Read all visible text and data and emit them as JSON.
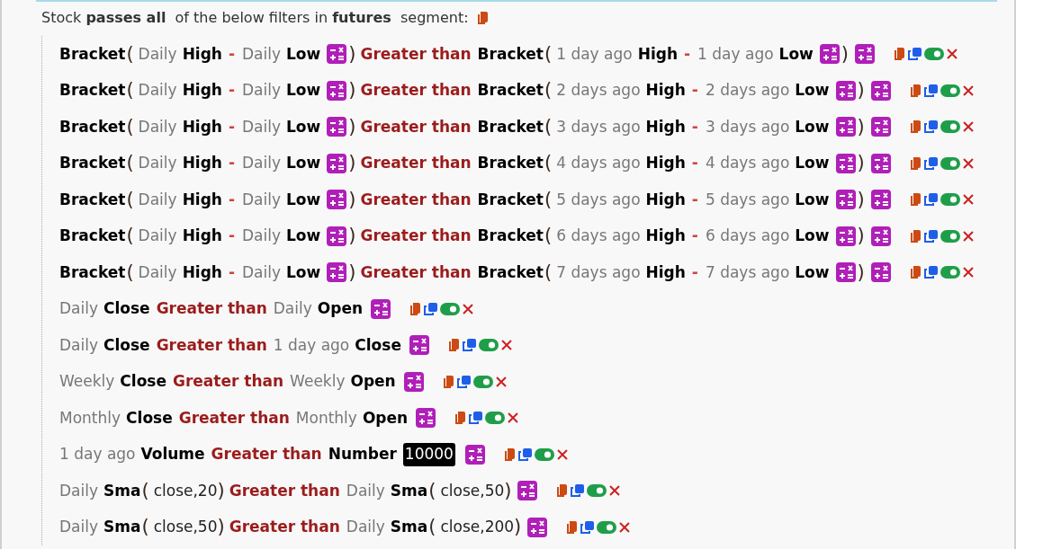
{
  "header": {
    "text": "Stock **passes all**  of the below filters in **futures**  segment:"
  },
  "filters": [
    {
      "enabled": true,
      "tokens": [
        {
          "kind": "bold",
          "text": "Bracket"
        },
        {
          "kind": "paren",
          "text": "("
        },
        {
          "kind": "muted",
          "text": "Daily"
        },
        {
          "kind": "bold",
          "text": "High"
        },
        {
          "kind": "minus",
          "text": "-"
        },
        {
          "kind": "muted",
          "text": "Daily"
        },
        {
          "kind": "bold",
          "text": "Low"
        },
        {
          "kind": "calc"
        },
        {
          "kind": "paren",
          "text": ")"
        },
        {
          "kind": "op",
          "text": "Greater than"
        },
        {
          "kind": "bold",
          "text": "Bracket"
        },
        {
          "kind": "paren",
          "text": "("
        },
        {
          "kind": "muted",
          "text": "1 day ago"
        },
        {
          "kind": "bold",
          "text": "High"
        },
        {
          "kind": "minus",
          "text": "-"
        },
        {
          "kind": "muted",
          "text": "1 day ago"
        },
        {
          "kind": "bold",
          "text": "Low"
        },
        {
          "kind": "calc"
        },
        {
          "kind": "paren",
          "text": ")"
        },
        {
          "kind": "calc"
        }
      ]
    },
    {
      "enabled": true,
      "tokens": [
        {
          "kind": "bold",
          "text": "Bracket"
        },
        {
          "kind": "paren",
          "text": "("
        },
        {
          "kind": "muted",
          "text": "Daily"
        },
        {
          "kind": "bold",
          "text": "High"
        },
        {
          "kind": "minus",
          "text": "-"
        },
        {
          "kind": "muted",
          "text": "Daily"
        },
        {
          "kind": "bold",
          "text": "Low"
        },
        {
          "kind": "calc"
        },
        {
          "kind": "paren",
          "text": ")"
        },
        {
          "kind": "op",
          "text": "Greater than"
        },
        {
          "kind": "bold",
          "text": "Bracket"
        },
        {
          "kind": "paren",
          "text": "("
        },
        {
          "kind": "muted",
          "text": "2 days ago"
        },
        {
          "kind": "bold",
          "text": "High"
        },
        {
          "kind": "minus",
          "text": "-"
        },
        {
          "kind": "muted",
          "text": "2 days ago"
        },
        {
          "kind": "bold",
          "text": "Low"
        },
        {
          "kind": "calc"
        },
        {
          "kind": "paren",
          "text": ")"
        },
        {
          "kind": "calc"
        }
      ]
    },
    {
      "enabled": true,
      "tokens": [
        {
          "kind": "bold",
          "text": "Bracket"
        },
        {
          "kind": "paren",
          "text": "("
        },
        {
          "kind": "muted",
          "text": "Daily"
        },
        {
          "kind": "bold",
          "text": "High"
        },
        {
          "kind": "minus",
          "text": "-"
        },
        {
          "kind": "muted",
          "text": "Daily"
        },
        {
          "kind": "bold",
          "text": "Low"
        },
        {
          "kind": "calc"
        },
        {
          "kind": "paren",
          "text": ")"
        },
        {
          "kind": "op",
          "text": "Greater than"
        },
        {
          "kind": "bold",
          "text": "Bracket"
        },
        {
          "kind": "paren",
          "text": "("
        },
        {
          "kind": "muted",
          "text": "3 days ago"
        },
        {
          "kind": "bold",
          "text": "High"
        },
        {
          "kind": "minus",
          "text": "-"
        },
        {
          "kind": "muted",
          "text": "3 days ago"
        },
        {
          "kind": "bold",
          "text": "Low"
        },
        {
          "kind": "calc"
        },
        {
          "kind": "paren",
          "text": ")"
        },
        {
          "kind": "calc"
        }
      ]
    },
    {
      "enabled": true,
      "tokens": [
        {
          "kind": "bold",
          "text": "Bracket"
        },
        {
          "kind": "paren",
          "text": "("
        },
        {
          "kind": "muted",
          "text": "Daily"
        },
        {
          "kind": "bold",
          "text": "High"
        },
        {
          "kind": "minus",
          "text": "-"
        },
        {
          "kind": "muted",
          "text": "Daily"
        },
        {
          "kind": "bold",
          "text": "Low"
        },
        {
          "kind": "calc"
        },
        {
          "kind": "paren",
          "text": ")"
        },
        {
          "kind": "op",
          "text": "Greater than"
        },
        {
          "kind": "bold",
          "text": "Bracket"
        },
        {
          "kind": "paren",
          "text": "("
        },
        {
          "kind": "muted",
          "text": "4 days ago"
        },
        {
          "kind": "bold",
          "text": "High"
        },
        {
          "kind": "minus",
          "text": "-"
        },
        {
          "kind": "muted",
          "text": "4 days ago"
        },
        {
          "kind": "bold",
          "text": "Low"
        },
        {
          "kind": "calc"
        },
        {
          "kind": "paren",
          "text": ")"
        },
        {
          "kind": "calc"
        }
      ]
    },
    {
      "enabled": true,
      "tokens": [
        {
          "kind": "bold",
          "text": "Bracket"
        },
        {
          "kind": "paren",
          "text": "("
        },
        {
          "kind": "muted",
          "text": "Daily"
        },
        {
          "kind": "bold",
          "text": "High"
        },
        {
          "kind": "minus",
          "text": "-"
        },
        {
          "kind": "muted",
          "text": "Daily"
        },
        {
          "kind": "bold",
          "text": "Low"
        },
        {
          "kind": "calc"
        },
        {
          "kind": "paren",
          "text": ")"
        },
        {
          "kind": "op",
          "text": "Greater than"
        },
        {
          "kind": "bold",
          "text": "Bracket"
        },
        {
          "kind": "paren",
          "text": "("
        },
        {
          "kind": "muted",
          "text": "5 days ago"
        },
        {
          "kind": "bold",
          "text": "High"
        },
        {
          "kind": "minus",
          "text": "-"
        },
        {
          "kind": "muted",
          "text": "5 days ago"
        },
        {
          "kind": "bold",
          "text": "Low"
        },
        {
          "kind": "calc"
        },
        {
          "kind": "paren",
          "text": ")"
        },
        {
          "kind": "calc"
        }
      ]
    },
    {
      "enabled": true,
      "tokens": [
        {
          "kind": "bold",
          "text": "Bracket"
        },
        {
          "kind": "paren",
          "text": "("
        },
        {
          "kind": "muted",
          "text": "Daily"
        },
        {
          "kind": "bold",
          "text": "High"
        },
        {
          "kind": "minus",
          "text": "-"
        },
        {
          "kind": "muted",
          "text": "Daily"
        },
        {
          "kind": "bold",
          "text": "Low"
        },
        {
          "kind": "calc"
        },
        {
          "kind": "paren",
          "text": ")"
        },
        {
          "kind": "op",
          "text": "Greater than"
        },
        {
          "kind": "bold",
          "text": "Bracket"
        },
        {
          "kind": "paren",
          "text": "("
        },
        {
          "kind": "muted",
          "text": "6 days ago"
        },
        {
          "kind": "bold",
          "text": "High"
        },
        {
          "kind": "minus",
          "text": "-"
        },
        {
          "kind": "muted",
          "text": "6 days ago"
        },
        {
          "kind": "bold",
          "text": "Low"
        },
        {
          "kind": "calc"
        },
        {
          "kind": "paren",
          "text": ")"
        },
        {
          "kind": "calc"
        }
      ]
    },
    {
      "enabled": true,
      "tokens": [
        {
          "kind": "bold",
          "text": "Bracket"
        },
        {
          "kind": "paren",
          "text": "("
        },
        {
          "kind": "muted",
          "text": "Daily"
        },
        {
          "kind": "bold",
          "text": "High"
        },
        {
          "kind": "minus",
          "text": "-"
        },
        {
          "kind": "muted",
          "text": "Daily"
        },
        {
          "kind": "bold",
          "text": "Low"
        },
        {
          "kind": "calc"
        },
        {
          "kind": "paren",
          "text": ")"
        },
        {
          "kind": "op",
          "text": "Greater than"
        },
        {
          "kind": "bold",
          "text": "Bracket"
        },
        {
          "kind": "paren",
          "text": "("
        },
        {
          "kind": "muted",
          "text": "7 days ago"
        },
        {
          "kind": "bold",
          "text": "High"
        },
        {
          "kind": "minus",
          "text": "-"
        },
        {
          "kind": "muted",
          "text": "7 days ago"
        },
        {
          "kind": "bold",
          "text": "Low"
        },
        {
          "kind": "calc"
        },
        {
          "kind": "paren",
          "text": ")"
        },
        {
          "kind": "calc"
        }
      ]
    },
    {
      "enabled": true,
      "tokens": [
        {
          "kind": "muted",
          "text": "Daily"
        },
        {
          "kind": "bold",
          "text": "Close"
        },
        {
          "kind": "op",
          "text": "Greater than"
        },
        {
          "kind": "muted",
          "text": "Daily"
        },
        {
          "kind": "bold",
          "text": "Open"
        },
        {
          "kind": "calc"
        }
      ]
    },
    {
      "enabled": true,
      "tokens": [
        {
          "kind": "muted",
          "text": "Daily"
        },
        {
          "kind": "bold",
          "text": "Close"
        },
        {
          "kind": "op",
          "text": "Greater than"
        },
        {
          "kind": "muted",
          "text": "1 day ago"
        },
        {
          "kind": "bold",
          "text": "Close"
        },
        {
          "kind": "calc"
        }
      ]
    },
    {
      "enabled": true,
      "tokens": [
        {
          "kind": "muted",
          "text": "Weekly"
        },
        {
          "kind": "bold",
          "text": "Close"
        },
        {
          "kind": "op",
          "text": "Greater than"
        },
        {
          "kind": "muted",
          "text": "Weekly"
        },
        {
          "kind": "bold",
          "text": "Open"
        },
        {
          "kind": "calc"
        }
      ]
    },
    {
      "enabled": true,
      "tokens": [
        {
          "kind": "muted",
          "text": "Monthly"
        },
        {
          "kind": "bold",
          "text": "Close"
        },
        {
          "kind": "op",
          "text": "Greater than"
        },
        {
          "kind": "muted",
          "text": "Monthly"
        },
        {
          "kind": "bold",
          "text": "Open"
        },
        {
          "kind": "calc"
        }
      ]
    },
    {
      "enabled": true,
      "tokens": [
        {
          "kind": "muted",
          "text": "1 day ago"
        },
        {
          "kind": "bold",
          "text": "Volume"
        },
        {
          "kind": "op",
          "text": "Greater than"
        },
        {
          "kind": "bold",
          "text": "Number"
        },
        {
          "kind": "number",
          "text": "10000"
        },
        {
          "kind": "calc"
        }
      ]
    },
    {
      "enabled": true,
      "tokens": [
        {
          "kind": "muted",
          "text": "Daily"
        },
        {
          "kind": "bold",
          "text": "Sma"
        },
        {
          "kind": "paren",
          "text": "("
        },
        {
          "kind": "param",
          "text": "close,20"
        },
        {
          "kind": "paren",
          "text": ")"
        },
        {
          "kind": "op",
          "text": "Greater than"
        },
        {
          "kind": "muted",
          "text": "Daily"
        },
        {
          "kind": "bold",
          "text": "Sma"
        },
        {
          "kind": "paren",
          "text": "("
        },
        {
          "kind": "param",
          "text": "close,50"
        },
        {
          "kind": "paren",
          "text": ")"
        },
        {
          "kind": "calc"
        }
      ]
    },
    {
      "enabled": true,
      "tokens": [
        {
          "kind": "muted",
          "text": "Daily"
        },
        {
          "kind": "bold",
          "text": "Sma"
        },
        {
          "kind": "paren",
          "text": "("
        },
        {
          "kind": "param",
          "text": "close,50"
        },
        {
          "kind": "paren",
          "text": ")"
        },
        {
          "kind": "op",
          "text": "Greater than"
        },
        {
          "kind": "muted",
          "text": "Daily"
        },
        {
          "kind": "bold",
          "text": "Sma"
        },
        {
          "kind": "paren",
          "text": "("
        },
        {
          "kind": "param",
          "text": "close,200"
        },
        {
          "kind": "paren",
          "text": ")"
        },
        {
          "kind": "calc"
        }
      ]
    }
  ]
}
